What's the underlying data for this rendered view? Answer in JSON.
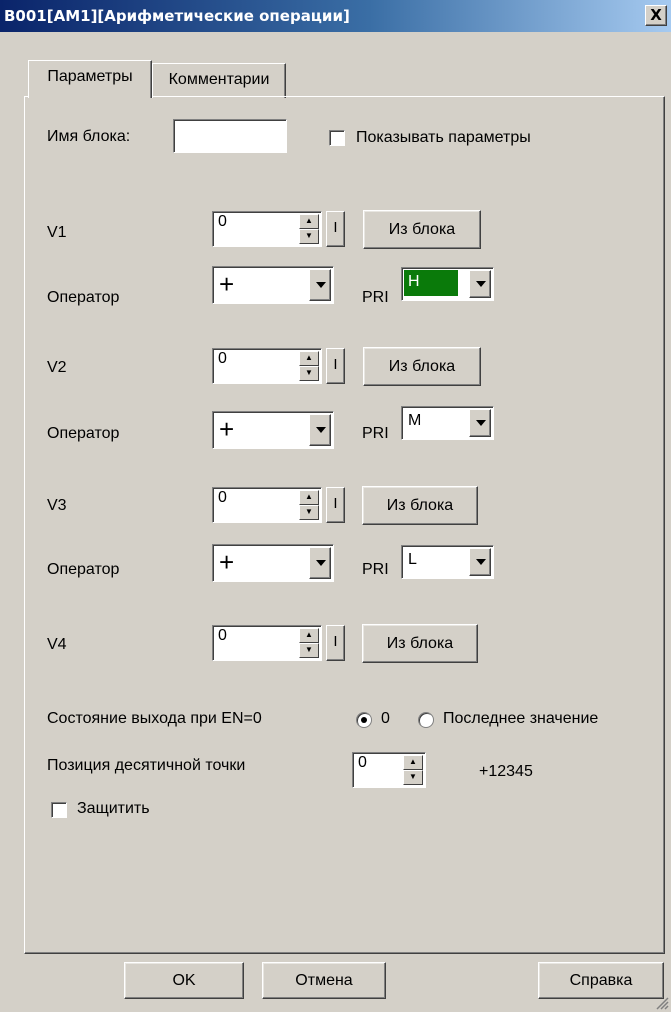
{
  "window": {
    "title": "B001[AM1][Арифметические операции]",
    "close_label": "X"
  },
  "tabs": [
    {
      "label": "Параметры",
      "active": true
    },
    {
      "label": "Комментарии",
      "active": false
    }
  ],
  "block_name": {
    "label": "Имя блока:",
    "value": ""
  },
  "show_params": {
    "label": "Показывать параметры",
    "checked": false
  },
  "inputs": [
    {
      "label": "V1",
      "value": "0",
      "i_label": "I",
      "from_block": "Из блока"
    },
    {
      "label": "V2",
      "value": "0",
      "i_label": "I",
      "from_block": "Из блока"
    },
    {
      "label": "V3",
      "value": "0",
      "i_label": "I",
      "from_block": "Из блока"
    },
    {
      "label": "V4",
      "value": "0",
      "i_label": "I",
      "from_block": "Из блока"
    }
  ],
  "operators": [
    {
      "label": "Оператор",
      "value": "+",
      "pri_label": "PRI",
      "pri_value": "H",
      "pri_highlight": "#0a7a0a"
    },
    {
      "label": "Оператор",
      "value": "+",
      "pri_label": "PRI",
      "pri_value": "M"
    },
    {
      "label": "Оператор",
      "value": "+",
      "pri_label": "PRI",
      "pri_value": "L"
    }
  ],
  "output_state": {
    "label": "Состояние выхода при EN=0",
    "options": [
      {
        "label": "0",
        "selected": true
      },
      {
        "label": "Последнее значение",
        "selected": false
      }
    ]
  },
  "decimal": {
    "label": "Позиция десятичной точки",
    "value": "0",
    "preview": "+12345"
  },
  "protect": {
    "label": "Защитить",
    "checked": false
  },
  "buttons": {
    "ok": "OK",
    "cancel": "Отмена",
    "help": "Справка"
  },
  "colors": {
    "title_start": "#0a246a",
    "title_end": "#a6caf0",
    "face": "#d4d0c8"
  }
}
